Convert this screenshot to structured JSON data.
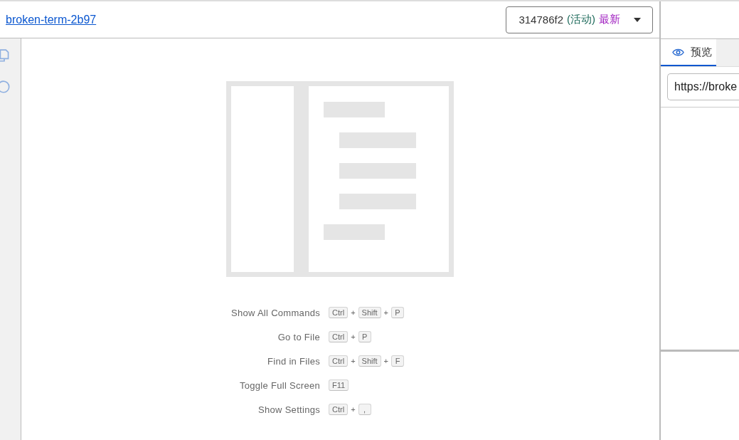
{
  "header": {
    "link": "broken-term-2b97",
    "version": {
      "commit": "314786f2",
      "status": "(活动)",
      "tag": "最新"
    }
  },
  "sidebar": {
    "icons": [
      {
        "kind": "files"
      },
      {
        "kind": "search"
      }
    ]
  },
  "shortcuts": [
    {
      "label": "Show All Commands",
      "keys": [
        {
          "kind": "key",
          "text": "Ctrl"
        },
        {
          "kind": "plus",
          "text": "+"
        },
        {
          "kind": "key",
          "text": "Shift"
        },
        {
          "kind": "plus",
          "text": "+"
        },
        {
          "kind": "key",
          "text": "P"
        }
      ]
    },
    {
      "label": "Go to File",
      "keys": [
        {
          "kind": "key",
          "text": "Ctrl"
        },
        {
          "kind": "plus",
          "text": "+"
        },
        {
          "kind": "key",
          "text": "P"
        }
      ]
    },
    {
      "label": "Find in Files",
      "keys": [
        {
          "kind": "key",
          "text": "Ctrl"
        },
        {
          "kind": "plus",
          "text": "+"
        },
        {
          "kind": "key",
          "text": "Shift"
        },
        {
          "kind": "plus",
          "text": "+"
        },
        {
          "kind": "key",
          "text": "F"
        }
      ]
    },
    {
      "label": "Toggle Full Screen",
      "keys": [
        {
          "kind": "key",
          "text": "F11"
        }
      ]
    },
    {
      "label": "Show Settings",
      "keys": [
        {
          "kind": "key",
          "text": "Ctrl"
        },
        {
          "kind": "plus",
          "text": "+"
        },
        {
          "kind": "key",
          "text": ","
        }
      ]
    }
  ],
  "preview": {
    "tabs": [
      {
        "label": "预览",
        "selected": true
      },
      {
        "selected": false
      }
    ],
    "url": "https://broke"
  }
}
